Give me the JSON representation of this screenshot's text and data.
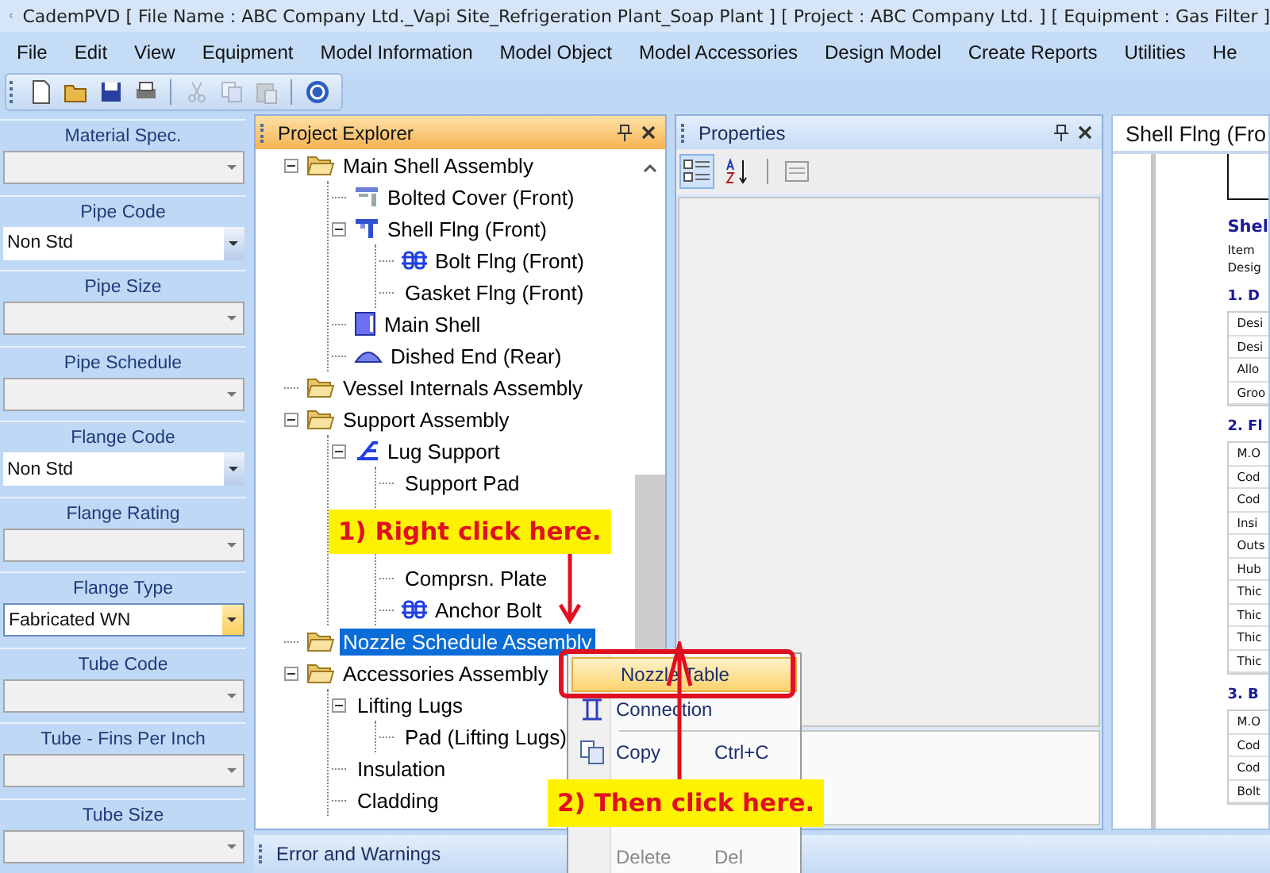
{
  "window": {
    "title": "CademPVD [ File Name : ABC Company Ltd._Vapi Site_Refrigeration Plant_Soap Plant ] [ Project : ABC Company Ltd. ] [ Equipment : Gas Filter ]"
  },
  "menu": [
    "File",
    "Edit",
    "View",
    "Equipment",
    "Model Information",
    "Model Object",
    "Model Accessories",
    "Design Model",
    "Create Reports",
    "Utilities",
    "He"
  ],
  "toolbar": [
    {
      "kind": "new",
      "disabled": false
    },
    {
      "kind": "open",
      "disabled": false
    },
    {
      "kind": "save",
      "disabled": false
    },
    {
      "kind": "print",
      "disabled": false
    },
    {
      "kind": "sep"
    },
    {
      "kind": "cut",
      "disabled": true
    },
    {
      "kind": "copy",
      "disabled": true
    },
    {
      "kind": "paste",
      "disabled": true
    },
    {
      "kind": "sep"
    },
    {
      "kind": "help",
      "disabled": false
    }
  ],
  "fields": [
    {
      "label": "Material Spec.",
      "disabled": true,
      "focused": false
    },
    {
      "label": "Pipe Code",
      "value": "Non Std",
      "disabled": false,
      "focused": false
    },
    {
      "label": "Pipe Size",
      "disabled": true,
      "focused": false
    },
    {
      "label": "Pipe Schedule",
      "disabled": true,
      "focused": false
    },
    {
      "label": "Flange Code",
      "value": "Non Std",
      "disabled": false,
      "focused": false
    },
    {
      "label": "Flange Rating",
      "disabled": true,
      "focused": false
    },
    {
      "label": "Flange Type",
      "value": "Fabricated WN",
      "disabled": false,
      "focused": true
    },
    {
      "label": "Tube Code",
      "disabled": true,
      "focused": false
    },
    {
      "label": "Tube - Fins Per Inch",
      "disabled": true,
      "focused": false
    },
    {
      "label": "Tube Size",
      "disabled": true,
      "focused": false
    }
  ],
  "explorer": {
    "title": "Project Explorer",
    "tree": [
      {
        "label": "Main Shell Assembly",
        "kind": "folder",
        "expanded": true,
        "selected": false,
        "children": [
          {
            "label": "Bolted Cover (Front)",
            "kind": "cover",
            "selected": false
          },
          {
            "label": "Shell Flng (Front)",
            "kind": "flange",
            "expanded": true,
            "selected": false,
            "children": [
              {
                "label": "Bolt Flng (Front)",
                "kind": "bolt",
                "selected": false
              },
              {
                "label": "Gasket Flng (Front)",
                "kind": "plain",
                "selected": false
              }
            ]
          },
          {
            "label": "Main Shell",
            "kind": "shell",
            "selected": false
          },
          {
            "label": "Dished End (Rear)",
            "kind": "dished",
            "selected": false
          }
        ]
      },
      {
        "label": "Vessel Internals Assembly",
        "kind": "folder",
        "selected": false
      },
      {
        "label": "Support Assembly",
        "kind": "folder",
        "expanded": true,
        "selected": false,
        "children": [
          {
            "label": "Lug Support",
            "kind": "lug",
            "expanded": true,
            "selected": false,
            "children": [
              {
                "label": "Support Pad",
                "kind": "plain",
                "selected": false
              },
              {
                "kind": "covered"
              },
              {
                "kind": "covered"
              },
              {
                "label": "Comprsn. Plate",
                "kind": "plain",
                "selected": false
              },
              {
                "label": "Anchor Bolt",
                "kind": "bolt",
                "selected": false
              }
            ]
          }
        ]
      },
      {
        "label": "Nozzle Schedule Assembly",
        "kind": "folder",
        "selected": true
      },
      {
        "label": "Accessories Assembly",
        "kind": "folder",
        "expanded": true,
        "selected": false,
        "children": [
          {
            "label": "Lifting Lugs",
            "kind": "plain",
            "expanded": true,
            "selected": false,
            "children": [
              {
                "label": "Pad (Lifting Lugs)",
                "kind": "plain",
                "selected": false
              }
            ]
          },
          {
            "label": "Insulation",
            "kind": "plain",
            "selected": false
          },
          {
            "label": "Cladding",
            "kind": "plain",
            "selected": false
          }
        ]
      }
    ]
  },
  "properties": {
    "title": "Properties",
    "tools": [
      {
        "kind": "categorized",
        "selected": true
      },
      {
        "kind": "alphabetical",
        "selected": false
      },
      {
        "kind": "pages",
        "selected": false
      }
    ]
  },
  "document": {
    "tab": "Shell Flng (Fro",
    "heading": "Shel",
    "meta": [
      "Item",
      "Desig"
    ],
    "sections": [
      {
        "title": "1. D",
        "rows": [
          "Desi",
          "Desi",
          "Allo",
          "Groo"
        ]
      },
      {
        "title": "2. Fl",
        "rows": [
          "M.O",
          "Cod",
          "Cod",
          "Insi",
          "Outs",
          "Hub",
          "Thic",
          "Thic",
          "Thic",
          "Thic"
        ]
      },
      {
        "title": "3. B",
        "rows": [
          "M.O",
          "Cod",
          "Cod",
          "Bolt"
        ]
      }
    ]
  },
  "errors_bar": {
    "title": "Error and Warnings"
  },
  "context_menu": [
    {
      "kind": "item",
      "label": "Nozzle Table",
      "selected": true,
      "disabled": false
    },
    {
      "kind": "connection",
      "label": "Connection",
      "selected": false,
      "disabled": false
    },
    {
      "kind": "separator"
    },
    {
      "kind": "copy",
      "label": "Copy",
      "shortcut": "Ctrl+C",
      "selected": false,
      "disabled": false
    },
    {
      "kind": "covered"
    },
    {
      "kind": "covered"
    },
    {
      "kind": "item",
      "label": "Delete",
      "shortcut": "Del",
      "selected": false,
      "disabled": true
    }
  ],
  "callouts": [
    "1) Right click here.",
    "2) Then click here."
  ]
}
